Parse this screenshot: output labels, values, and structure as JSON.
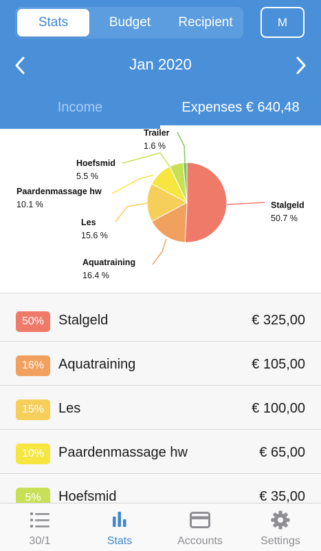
{
  "header": {
    "segments": [
      "Stats",
      "Budget",
      "Recipient"
    ],
    "active_segment": "Stats",
    "profile_initial": "M",
    "month": "Jan 2020",
    "tabs": {
      "income": "Income",
      "expenses": "Expenses € 640,48"
    }
  },
  "chart_data": {
    "type": "pie",
    "slices": [
      {
        "name": "Stalgeld",
        "pct_label": "50.7 %",
        "value": 50.7,
        "color": "#ef7a6a"
      },
      {
        "name": "Aquatraining",
        "pct_label": "16.4 %",
        "value": 16.4,
        "color": "#f2a05d"
      },
      {
        "name": "Les",
        "pct_label": "15.6 %",
        "value": 15.6,
        "color": "#f5cf5a"
      },
      {
        "name": "Paardenmassage hw",
        "pct_label": "10.1 %",
        "value": 10.1,
        "color": "#f7e640"
      },
      {
        "name": "Hoefsmid",
        "pct_label": "5.5 %",
        "value": 5.5,
        "color": "#c7e055"
      },
      {
        "name": "Trailer",
        "pct_label": "1.6 %",
        "value": 1.6,
        "color": "#7fc85a"
      }
    ]
  },
  "list": {
    "rows": [
      {
        "badge": "50%",
        "name": "Stalgeld",
        "amount": "€ 325,00",
        "color": "#ef7a6a"
      },
      {
        "badge": "16%",
        "name": "Aquatraining",
        "amount": "€ 105,00",
        "color": "#f2a05d"
      },
      {
        "badge": "15%",
        "name": "Les",
        "amount": "€ 100,00",
        "color": "#f5cf5a"
      },
      {
        "badge": "10%",
        "name": "Paardenmassage hw",
        "amount": "€ 65,00",
        "color": "#f7e640"
      },
      {
        "badge": "5%",
        "name": "Hoefsmid",
        "amount": "€ 35,00",
        "color": "#c7e055"
      }
    ]
  },
  "tabbar": {
    "items": [
      {
        "label": "30/1",
        "icon": "list-icon"
      },
      {
        "label": "Stats",
        "icon": "bar-chart-icon"
      },
      {
        "label": "Accounts",
        "icon": "card-icon"
      },
      {
        "label": "Settings",
        "icon": "gear-icon"
      }
    ],
    "active": "Stats"
  },
  "colors": {
    "header_blue": "#4a90d9",
    "active_blue": "#3f86d6",
    "inactive_gray": "#8e8e93"
  }
}
